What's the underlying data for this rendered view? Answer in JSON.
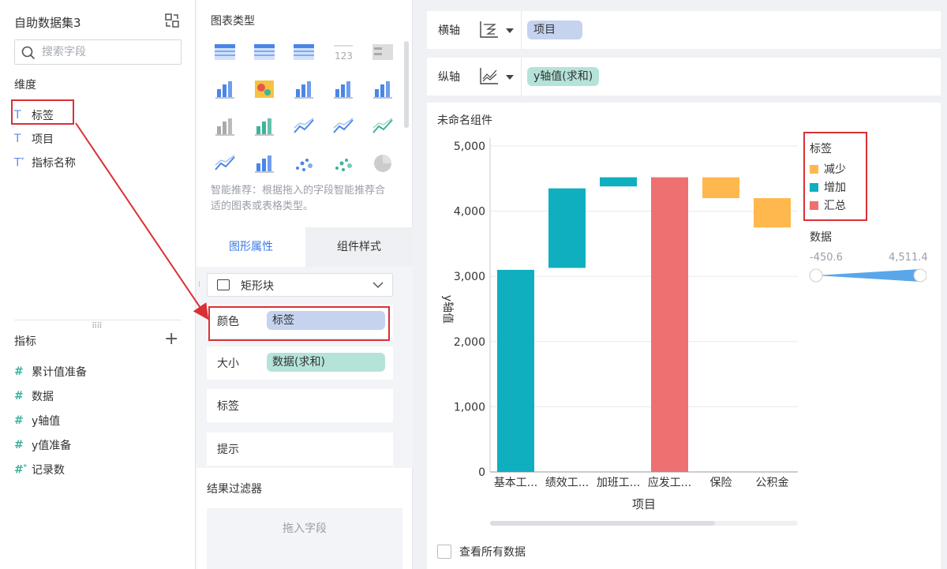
{
  "left": {
    "dataset_title": "自助数据集3",
    "search_placeholder": "搜索字段",
    "dimension_title": "维度",
    "dimensions": [
      {
        "type": "T",
        "label": "标签"
      },
      {
        "type": "T",
        "label": "项目"
      },
      {
        "type": "T*",
        "label": "指标名称"
      }
    ],
    "measure_title": "指标",
    "measures": [
      {
        "type": "#",
        "label": "累计值准备"
      },
      {
        "type": "#",
        "label": "数据"
      },
      {
        "type": "#",
        "label": "y轴值"
      },
      {
        "type": "#",
        "label": "y值准备"
      },
      {
        "type": "#*",
        "label": "记录数"
      }
    ]
  },
  "middle": {
    "chart_types_title": "图表类型",
    "smart_recommend": "智能推荐：根据拖入的字段智能推荐合适的图表或表格类型。",
    "tabs": [
      "图形属性",
      "组件样式"
    ],
    "shape": "矩形块",
    "props": [
      {
        "label": "颜色",
        "value": "标签"
      },
      {
        "label": "大小",
        "value": "数据(求和)"
      },
      {
        "label": "标签",
        "value": ""
      },
      {
        "label": "提示",
        "value": ""
      }
    ],
    "filter_title": "结果过滤器",
    "drop_hint": "拖入字段"
  },
  "axes": {
    "x_label": "横轴",
    "x_field": "项目",
    "y_label": "纵轴",
    "y_field": "y轴值(求和)"
  },
  "chart_panel": {
    "component_title": "未命名组件",
    "legend_title": "标签",
    "legend": [
      {
        "label": "减少",
        "color": "#ffb84d"
      },
      {
        "label": "增加",
        "color": "#0fafbf"
      },
      {
        "label": "汇总",
        "color": "#ef7070"
      }
    ],
    "data_title": "数据",
    "range_min": "-450.6",
    "range_max": "4,511.4",
    "view_all": "查看所有数据"
  },
  "chart_data": {
    "type": "bar",
    "subtype": "waterfall",
    "categories": [
      "基本工...",
      "绩效工...",
      "加班工...",
      "应发工...",
      "保险",
      "公积金"
    ],
    "bars": [
      {
        "category": "基本工...",
        "start": 0,
        "end": 3100,
        "label": "增加"
      },
      {
        "category": "绩效工...",
        "start": 3130,
        "end": 4350,
        "label": "增加"
      },
      {
        "category": "加班工...",
        "start": 4380,
        "end": 4520,
        "label": "增加"
      },
      {
        "category": "应发工...",
        "start": 0,
        "end": 4520,
        "label": "汇总"
      },
      {
        "category": "保险",
        "start": 4200,
        "end": 4520,
        "label": "减少"
      },
      {
        "category": "公积金",
        "start": 3750,
        "end": 4200,
        "label": "减少"
      }
    ],
    "yticks": [
      "0",
      "1,000",
      "2,000",
      "3,000",
      "4,000",
      "5,000"
    ],
    "ylim": [
      0,
      5000
    ],
    "xlabel": "项目",
    "ylabel": "y轴值",
    "grid": true,
    "legend_position": "right"
  }
}
